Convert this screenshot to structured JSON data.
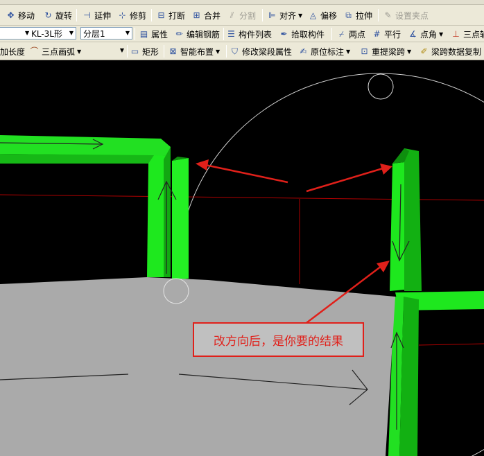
{
  "toolbar1": {
    "move": "移动",
    "rotate": "旋转",
    "extend": "延伸",
    "trim": "修剪",
    "break": "打断",
    "merge": "合并",
    "split": "分割",
    "align": "对齐",
    "offset": "偏移",
    "stretch": "拉伸",
    "set_grip": "设置夹点"
  },
  "toolbar2": {
    "component_select": "KL-3L形",
    "layer_select": "分层1",
    "properties": "属性",
    "edit_rebar": "编辑钢筋",
    "component_list": "构件列表",
    "pick_component": "拾取构件",
    "two_points": "两点",
    "parallel": "平行",
    "point_angle": "点角",
    "three_point": "三点轴"
  },
  "toolbar3": {
    "add_length": "加长度",
    "three_point_arc": "三点画弧",
    "rectangle": "矩形",
    "smart_layout": "智能布置",
    "modify_beam_section": "修改梁段属性",
    "origin_annotation": "原位标注",
    "re_extract_span": "重提梁跨",
    "copy_span_data": "梁跨数据复制"
  },
  "annotation": {
    "text": "改方向后，是你要的结果"
  },
  "colors": {
    "beam_green": "#1ee81e",
    "beam_green_dark": "#12b012",
    "slab_gray": "#aaaaaa",
    "axis_red": "#b00000",
    "arrow_red": "#e0201a"
  }
}
